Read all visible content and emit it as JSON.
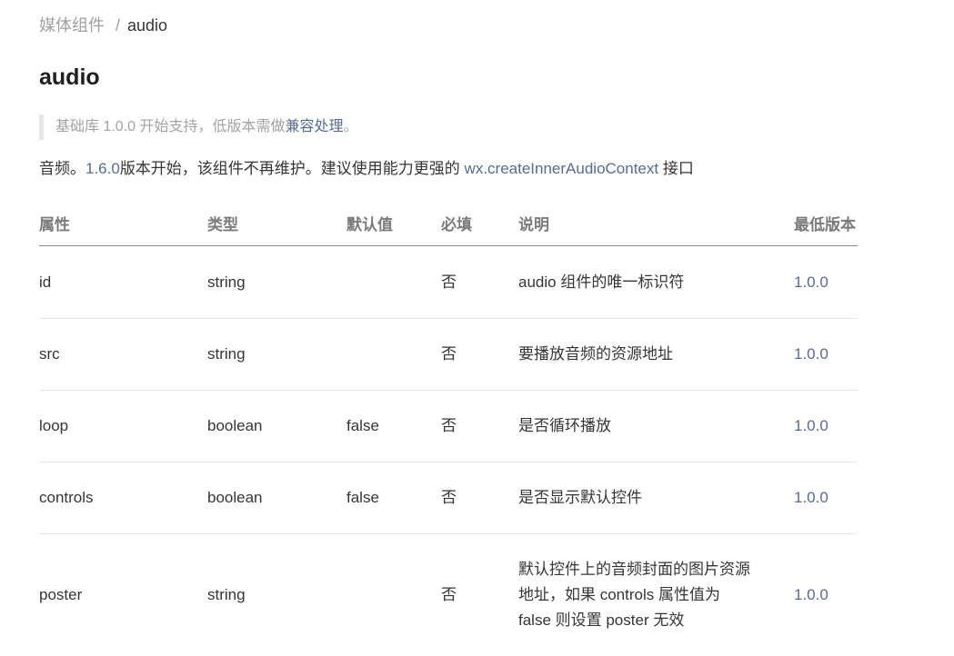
{
  "breadcrumb": {
    "parent": "媒体组件",
    "separator": "/",
    "current": "audio"
  },
  "title": "audio",
  "note": {
    "prefix": "基础库 1.0.0 开始支持，低版本需做",
    "link": "兼容处理",
    "suffix": "。"
  },
  "intro": {
    "prefix": "音频。",
    "version_link": "1.6.0",
    "middle": "版本开始，该组件不再维护。建议使用能力更强的 ",
    "api_link": "wx.createInnerAudioContext",
    "suffix": " 接口"
  },
  "table": {
    "headers": {
      "name": "属性",
      "type": "类型",
      "default": "默认值",
      "required": "必填",
      "desc": "说明",
      "version": "最低版本"
    },
    "rows": [
      {
        "name": "id",
        "type": "string",
        "default": "",
        "required": "否",
        "desc": "audio 组件的唯一标识符",
        "version": "1.0.0"
      },
      {
        "name": "src",
        "type": "string",
        "default": "",
        "required": "否",
        "desc": "要播放音频的资源地址",
        "version": "1.0.0"
      },
      {
        "name": "loop",
        "type": "boolean",
        "default": "false",
        "required": "否",
        "desc": "是否循环播放",
        "version": "1.0.0"
      },
      {
        "name": "controls",
        "type": "boolean",
        "default": "false",
        "required": "否",
        "desc": "是否显示默认控件",
        "version": "1.0.0"
      },
      {
        "name": "poster",
        "type": "string",
        "default": "",
        "required": "否",
        "desc": "默认控件上的音频封面的图片资源地址，如果 controls 属性值为 false 则设置 poster 无效",
        "version": "1.0.0"
      }
    ]
  },
  "colors": {
    "link": "#576b95",
    "muted": "#a0a0a0",
    "text": "#353535"
  }
}
